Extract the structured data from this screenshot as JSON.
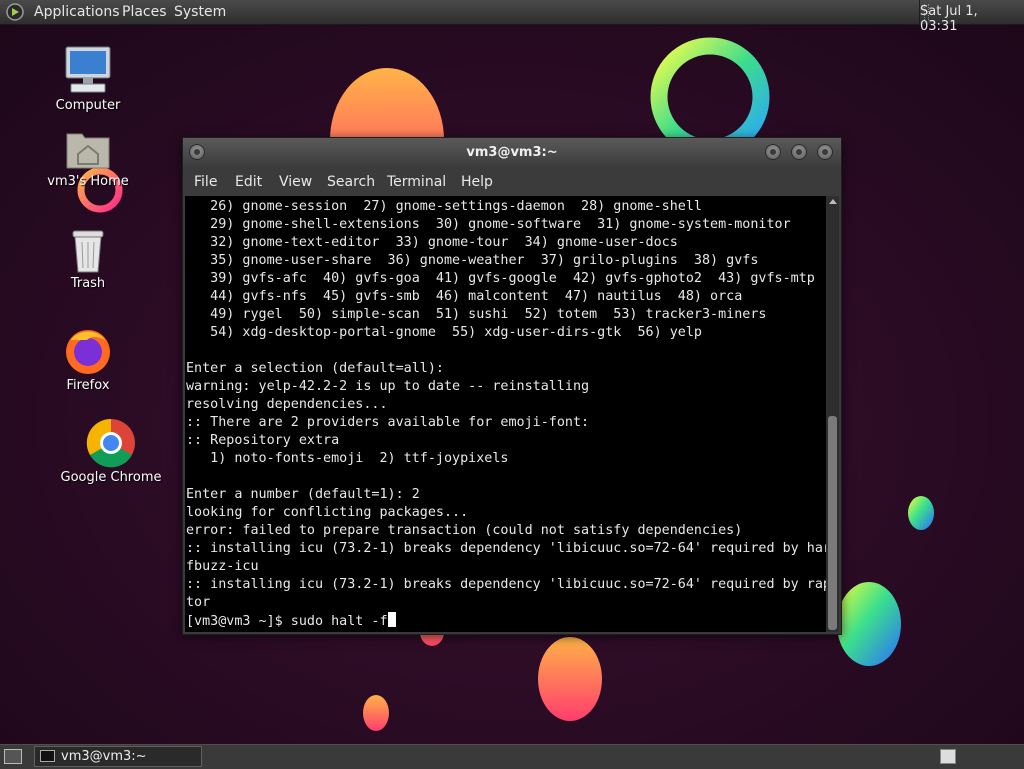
{
  "top_panel": {
    "menu": [
      "Applications",
      "Places",
      "System"
    ],
    "clock": "Sat Jul 1, 03:31"
  },
  "desktop_icons": [
    "Computer",
    "vm3's Home",
    "Trash",
    "Firefox",
    "Google Chrome"
  ],
  "terminal": {
    "title": "vm3@vm3:~",
    "menu": [
      "File",
      "Edit",
      "View",
      "Search",
      "Terminal",
      "Help"
    ],
    "lines": [
      "   26) gnome-session  27) gnome-settings-daemon  28) gnome-shell",
      "   29) gnome-shell-extensions  30) gnome-software  31) gnome-system-monitor",
      "   32) gnome-text-editor  33) gnome-tour  34) gnome-user-docs",
      "   35) gnome-user-share  36) gnome-weather  37) grilo-plugins  38) gvfs",
      "   39) gvfs-afc  40) gvfs-goa  41) gvfs-google  42) gvfs-gphoto2  43) gvfs-mtp",
      "   44) gvfs-nfs  45) gvfs-smb  46) malcontent  47) nautilus  48) orca",
      "   49) rygel  50) simple-scan  51) sushi  52) totem  53) tracker3-miners",
      "   54) xdg-desktop-portal-gnome  55) xdg-user-dirs-gtk  56) yelp",
      "",
      "Enter a selection (default=all):",
      "warning: yelp-42.2-2 is up to date -- reinstalling",
      "resolving dependencies...",
      ":: There are 2 providers available for emoji-font:",
      ":: Repository extra",
      "   1) noto-fonts-emoji  2) ttf-joypixels",
      "",
      "Enter a number (default=1): 2",
      "looking for conflicting packages...",
      "error: failed to prepare transaction (could not satisfy dependencies)",
      ":: installing icu (73.2-1) breaks dependency 'libicuuc.so=72-64' required by har",
      "fbuzz-icu",
      ":: installing icu (73.2-1) breaks dependency 'libicuuc.so=72-64' required by rap",
      "tor"
    ],
    "prompt": "[vm3@vm3 ~]$ sudo halt -f"
  },
  "taskbar": {
    "task_label": "vm3@vm3:~"
  }
}
